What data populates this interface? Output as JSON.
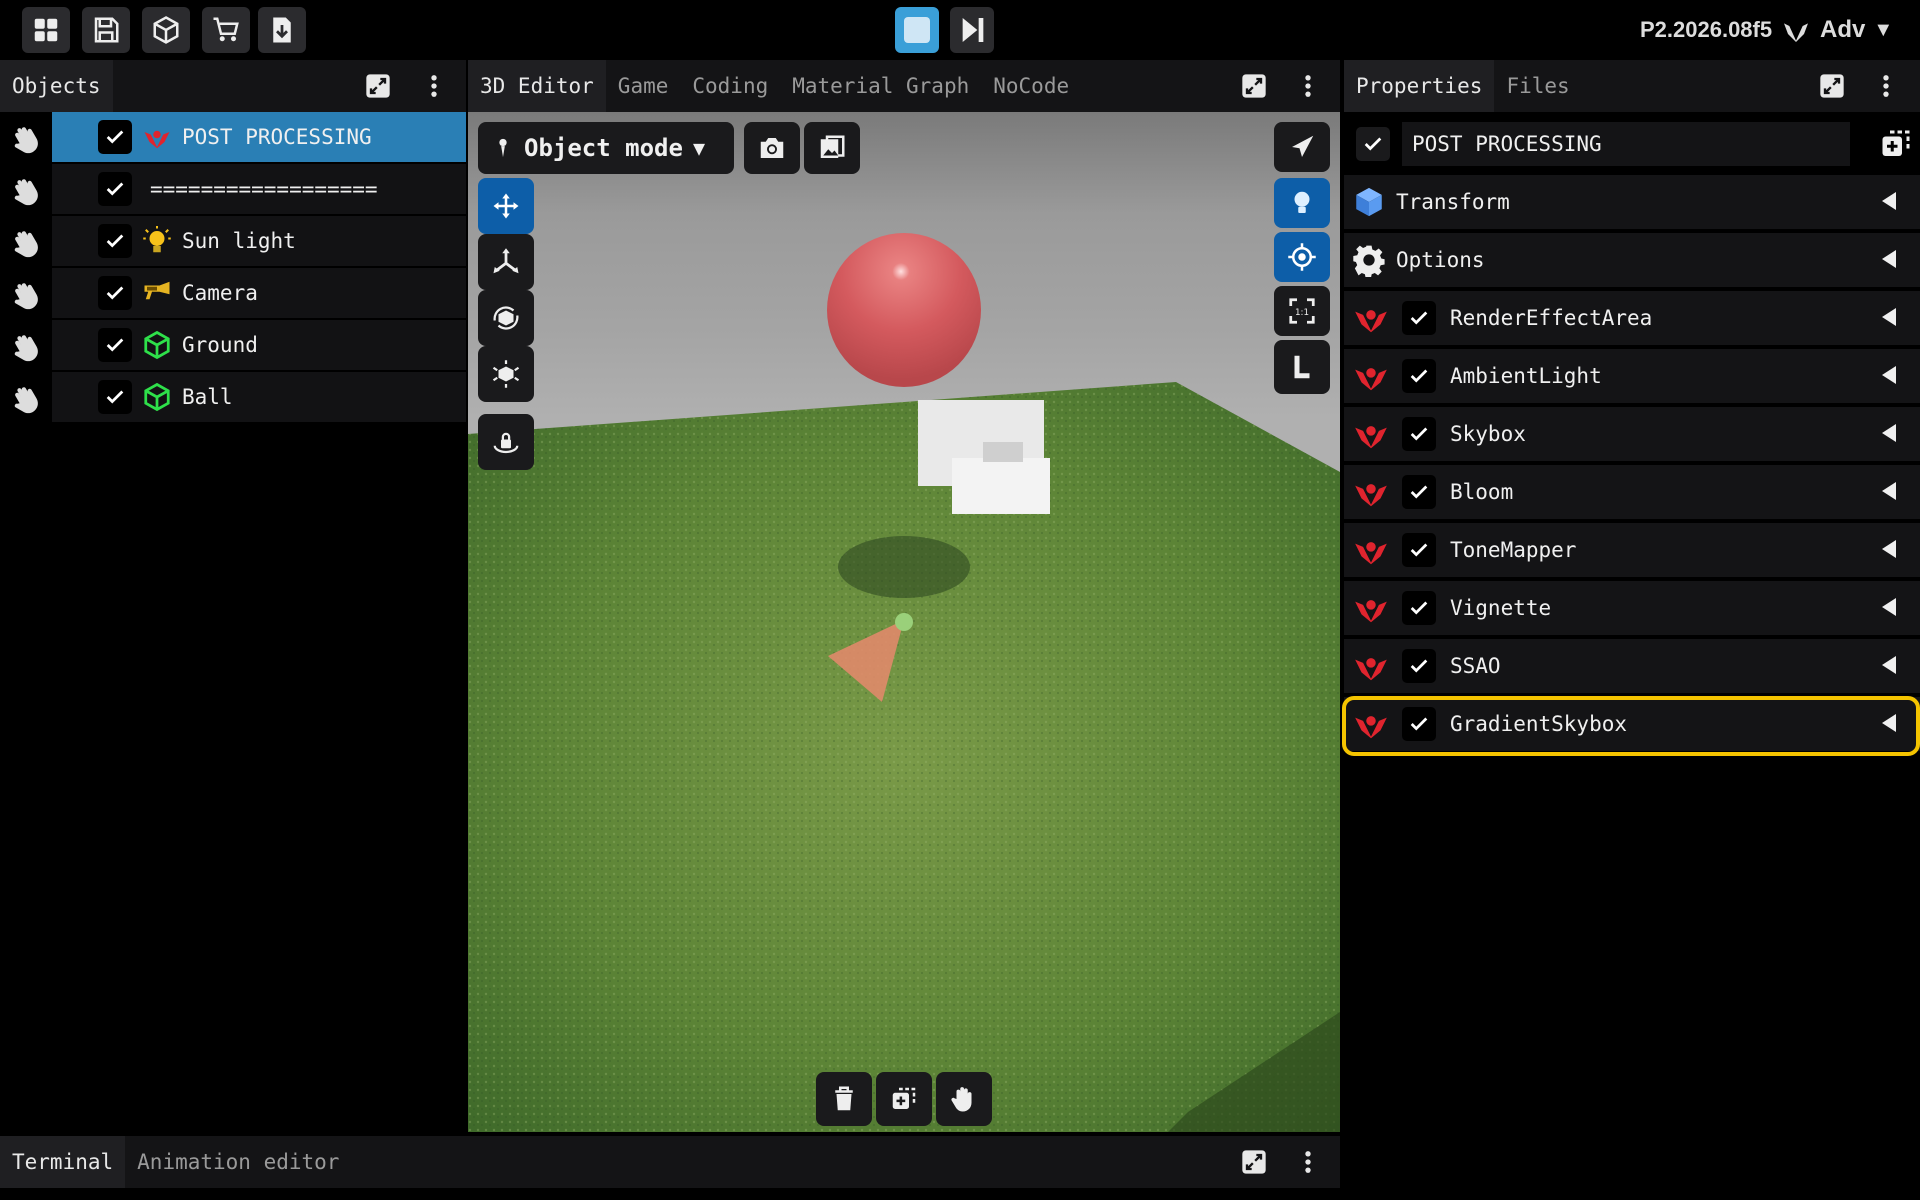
{
  "topbar": {
    "icons": [
      "grid-icon",
      "save-icon",
      "cube-icon",
      "cart-icon",
      "download-icon"
    ],
    "stop_color": "#3a9fd8",
    "version": "P2.2026.08f5",
    "account": "Adv"
  },
  "objects_panel": {
    "title": "Objects",
    "items": [
      {
        "label": "POST PROCESSING",
        "icon": "eye-effect-icon",
        "selected": true
      },
      {
        "label": "==================",
        "icon": "",
        "selected": false
      },
      {
        "label": "Sun light",
        "icon": "bulb-icon",
        "selected": false
      },
      {
        "label": "Camera",
        "icon": "camera-icon",
        "selected": false
      },
      {
        "label": "Ground",
        "icon": "mesh-icon",
        "selected": false
      },
      {
        "label": "Ball",
        "icon": "mesh-icon",
        "selected": false
      }
    ]
  },
  "editor": {
    "tabs": [
      "3D Editor",
      "Game",
      "Coding",
      "Material Graph",
      "NoCode"
    ],
    "active_tab": "3D Editor",
    "mode_label": "Object mode"
  },
  "properties": {
    "tabs": [
      "Properties",
      "Files"
    ],
    "active_tab": "Properties",
    "object_name": "POST PROCESSING",
    "sections": [
      "Transform",
      "Options"
    ],
    "effects": [
      "RenderEffectArea",
      "AmbientLight",
      "Skybox",
      "Bloom",
      "ToneMapper",
      "Vignette",
      "SSAO",
      "GradientSkybox"
    ],
    "highlighted_effect": "GradientSkybox",
    "highlight_color": "#f5c400"
  },
  "bottom_panel": {
    "tabs": [
      "Terminal",
      "Animation editor"
    ],
    "active_tab": "Terminal"
  }
}
